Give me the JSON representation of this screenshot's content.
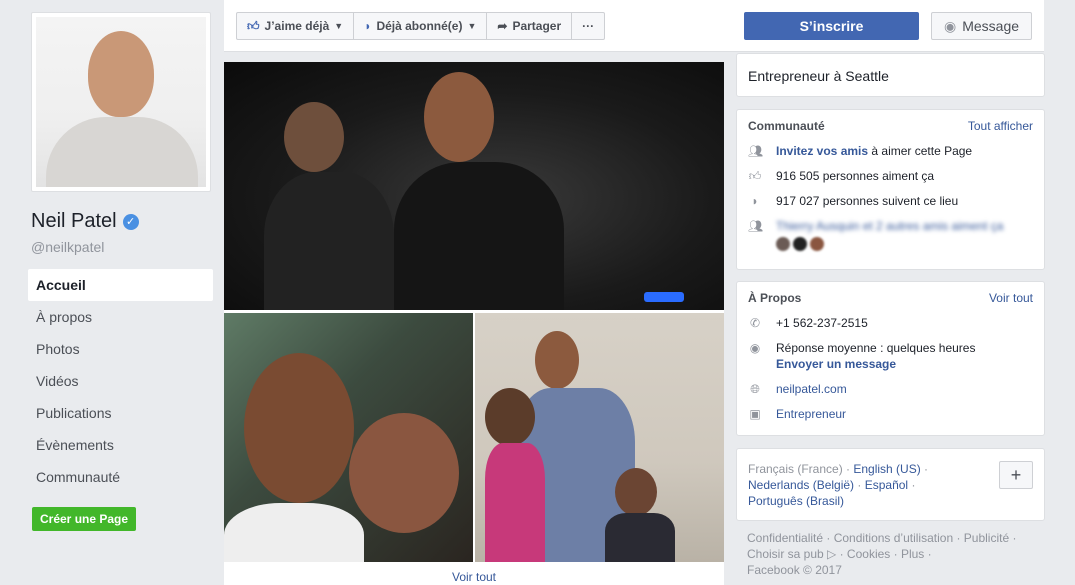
{
  "profile": {
    "name": "Neil Patel",
    "username": "@neilkpatel"
  },
  "nav": {
    "items": [
      "Accueil",
      "À propos",
      "Photos",
      "Vidéos",
      "Publications",
      "Évènements",
      "Communauté"
    ],
    "active": "Accueil"
  },
  "create_page_label": "Créer une Page",
  "actions": {
    "like_label": "J’aime déjà",
    "follow_label": "Déjà abonné(e)",
    "share_label": "Partager",
    "more_label": "···",
    "signup_label": "S’inscrire",
    "message_label": "Message"
  },
  "photos": {
    "see_all": "Voir tout"
  },
  "category": {
    "text": "Entrepreneur à Seattle"
  },
  "community": {
    "title": "Communauté",
    "see_all": "Tout afficher",
    "invite_link": "Invitez vos amis",
    "invite_rest": " à aimer cette Page",
    "likes": "916 505 personnes aiment ça",
    "follows": "917 027 personnes suivent ce lieu",
    "friends_text": "Thierry Ausquin et 2 autres amis aiment ça"
  },
  "about": {
    "title": "À Propos",
    "see_all": "Voir tout",
    "phone": "+1 562-237-2515",
    "response": "Réponse moyenne : quelques heures",
    "send_message": "Envoyer un message",
    "website": "neilpatel.com",
    "category": "Entrepreneur"
  },
  "languages": {
    "current": "Français (France)",
    "others": [
      "English (US)",
      "Nederlands (België)",
      "Español",
      "Português (Brasil)"
    ],
    "plus_label": "+"
  },
  "footer": {
    "line1": "Confidentialité · Conditions d’utilisation · Publicité ·",
    "line2": "Choisir sa pub ▷ · Cookies · Plus ·",
    "line3": "Facebook © 2017"
  },
  "colors": {
    "accent": "#4267b2",
    "link": "#365899",
    "green": "#42b72a",
    "background": "#e9ebee"
  }
}
